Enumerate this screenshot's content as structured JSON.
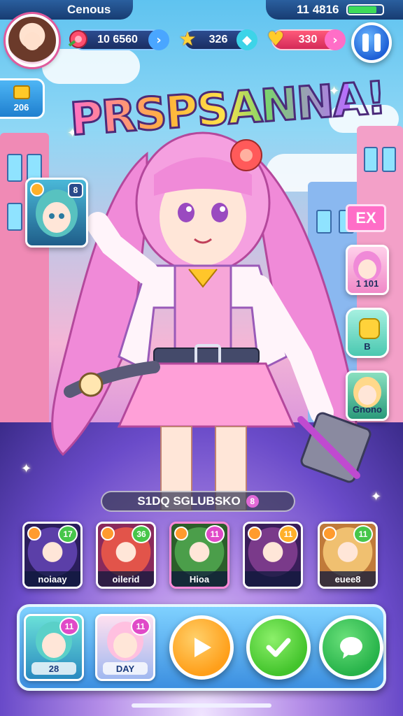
{
  "status_bar": {
    "carrier": "Cenous",
    "time": "11 4816",
    "battery_level": 0.85
  },
  "hud": {
    "currency_1": "10 6560",
    "currency_2": "326",
    "currency_3": "330",
    "icons": {
      "avatar": "player-avatar",
      "currency_1": "rose-icon",
      "currency_2": "star-icon",
      "currency_3": "heart-icon",
      "pause": "pause-icon"
    }
  },
  "mail": {
    "count": "206"
  },
  "title": "PRSPSANNA!",
  "left_card": {
    "badge": "8"
  },
  "right_panel": {
    "top_label": "EX",
    "card_1_label": "1 101",
    "card_2_label": "B",
    "card_3_label": "Gnono"
  },
  "squad": {
    "label": "S1DQ  SGLUBSKO",
    "badge": "8"
  },
  "roster": [
    {
      "name": "noiaay",
      "level": "17",
      "colors": [
        "#5b3fa8",
        "#2b1e5c"
      ]
    },
    {
      "name": "oilerid",
      "level": "36",
      "colors": [
        "#e2544a",
        "#8a2a5c"
      ]
    },
    {
      "name": "Hioa",
      "level": "11",
      "colors": [
        "#4b9e4a",
        "#2b5e2a"
      ]
    },
    {
      "name": "",
      "level": "11",
      "colors": [
        "#7a3a8a",
        "#3a1e5a"
      ]
    },
    {
      "name": "euee8",
      "level": "11",
      "colors": [
        "#f0c070",
        "#c07a3a"
      ]
    }
  ],
  "dock": {
    "card_1": {
      "label": "28",
      "level": "11"
    },
    "card_2": {
      "label": "DAY",
      "level": "11"
    },
    "buttons": {
      "play": "play-icon",
      "confirm": "checkmark-icon",
      "chat": "chat-icon"
    }
  },
  "colors": {
    "play": "#ff9f1a",
    "confirm": "#43c42c",
    "chat": "#27b34a",
    "accent_pink": "#ff6ec7"
  }
}
